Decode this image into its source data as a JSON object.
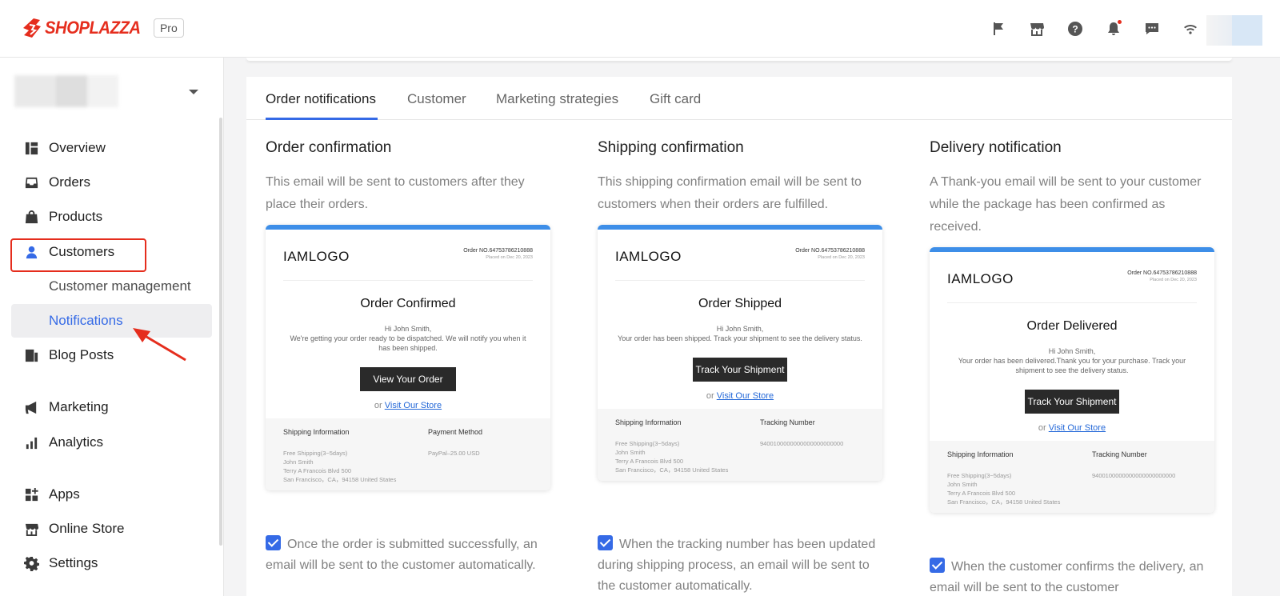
{
  "header": {
    "brand": "SHOPLAZZA",
    "plan_badge": "Pro",
    "icons": [
      "flag-icon",
      "store-icon",
      "help-icon",
      "bell-icon",
      "chat-icon",
      "wifi-icon"
    ]
  },
  "sidebar": {
    "items": [
      {
        "label": "Overview",
        "icon": "overview-icon"
      },
      {
        "label": "Orders",
        "icon": "inbox-icon"
      },
      {
        "label": "Products",
        "icon": "bag-icon"
      },
      {
        "label": "Customers",
        "icon": "person-icon"
      },
      {
        "label": "Blog Posts",
        "icon": "blog-icon"
      },
      {
        "label": "Marketing",
        "icon": "megaphone-icon"
      },
      {
        "label": "Analytics",
        "icon": "bar-chart-icon"
      },
      {
        "label": "Apps",
        "icon": "apps-icon"
      },
      {
        "label": "Online Store",
        "icon": "store-icon"
      },
      {
        "label": "Settings",
        "icon": "gear-icon"
      }
    ],
    "sub_items": [
      {
        "label": "Customer management"
      },
      {
        "label": "Notifications"
      }
    ],
    "active_color": "#356ae6",
    "highlight_color": "#e52d1d"
  },
  "tabs": [
    "Order notifications",
    "Customer",
    "Marketing strategies",
    "Gift card"
  ],
  "columns": [
    {
      "title": "Order confirmation",
      "description": "This email will be sent to customers after they place their orders.",
      "preview": {
        "logo": "IAMLOGO",
        "order_no": "Order NO.64753786210888",
        "placed": "Placed on Dec 20, 2023",
        "heading": "Order Confirmed",
        "greeting": "Hi  John Smith,",
        "message": "We're getting your order ready to be dispatched. We will notify you when it has been shipped.",
        "button": "View Your Order",
        "or": "or",
        "store_link": "Visit Our Store",
        "foot_left_title": "Shipping Information",
        "foot_left_lines": [
          "Free Shipping(3~5days)",
          "John Smith",
          "Terry A Francois Blvd 500",
          "San Francisco，CA，94158 United States"
        ],
        "foot_right_title": "Payment Method",
        "foot_right_value": "PayPal–25.00 USD"
      },
      "checkbox_label": "Once the order is submitted successfully, an email will be sent to the customer automatically."
    },
    {
      "title": "Shipping confirmation",
      "description": "This shipping confirmation email will be sent to customers when their orders are fulfilled.",
      "preview": {
        "logo": "IAMLOGO",
        "order_no": "Order NO.64753786210888",
        "placed": "Placed on Dec 20, 2023",
        "heading": "Order Shipped",
        "greeting": "Hi  John Smith,",
        "message": "Your order has been shipped. Track your shipment to see the delivery status.",
        "button": "Track Your Shipment",
        "or": "or",
        "store_link": "Visit Our Store",
        "foot_left_title": "Shipping Information",
        "foot_left_lines": [
          "Free Shipping(3~5days)",
          "John Smith",
          "Terry A Francois Blvd 500",
          "San Francisco，CA，94158 United States"
        ],
        "foot_right_title": "Tracking Number",
        "foot_right_value": "9400100000000000000000000"
      },
      "checkbox_label": "When the tracking number has been updated during shipping process, an email will be sent to the customer automatically."
    },
    {
      "title": "Delivery notification",
      "description": "A Thank-you email will be sent to your customer while the package has been confirmed as received.",
      "preview": {
        "logo": "IAMLOGO",
        "order_no": "Order NO.64753786210888",
        "placed": "Placed on Dec 20, 2023",
        "heading": "Order Delivered",
        "greeting": "Hi  John Smith,",
        "message": "Your order has been delivered.Thank you for your purchase. Track your shipment to see the delivery status.",
        "button": "Track Your Shipment",
        "or": "or",
        "store_link": "Visit Our Store",
        "foot_left_title": "Shipping Information",
        "foot_left_lines": [
          "Free Shipping(3~5days)",
          "John Smith",
          "Terry A Francois Blvd 500",
          "San Francisco，CA，94158 United States"
        ],
        "foot_right_title": "Tracking Number",
        "foot_right_value": "9400100000000000000000000"
      },
      "checkbox_label": "When the customer confirms the delivery, an email will be sent to the customer"
    }
  ]
}
